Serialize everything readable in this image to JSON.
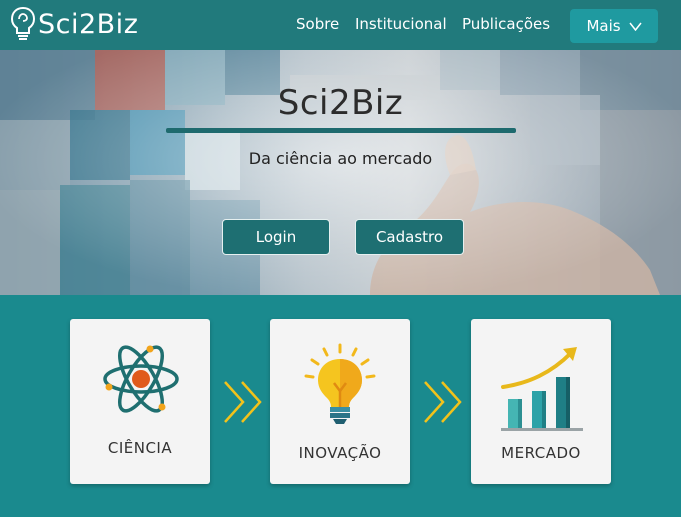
{
  "brand": {
    "name": "Sci2Biz"
  },
  "nav": {
    "items": [
      {
        "label": "Sobre"
      },
      {
        "label": "Institucional"
      },
      {
        "label": "Publicações"
      }
    ],
    "more_label": "Mais"
  },
  "hero": {
    "title": "Sci2Biz",
    "subtitle": "Da ciência ao mercado",
    "login_label": "Login",
    "signup_label": "Cadastro"
  },
  "features": [
    {
      "label": "CIÊNCIA",
      "icon": "atom-icon"
    },
    {
      "label": "INOVAÇÃO",
      "icon": "lightbulb-icon"
    },
    {
      "label": "MERCADO",
      "icon": "growth-chart-icon"
    }
  ],
  "colors": {
    "header": "#217a7c",
    "accent": "#1f9aa0",
    "button": "#1e6f72",
    "features_bg": "#1a8a8e",
    "arrow": "#f2c21b"
  }
}
